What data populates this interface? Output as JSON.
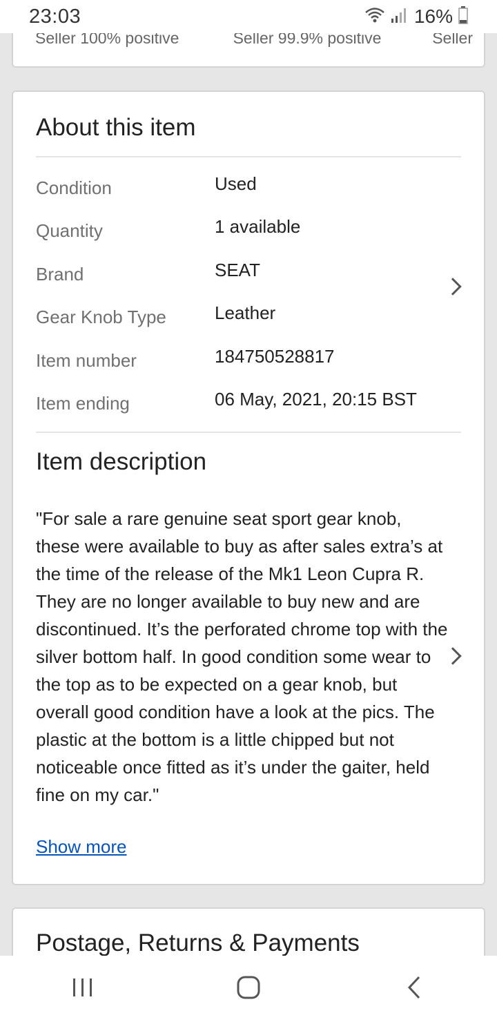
{
  "status_bar": {
    "time": "23:03",
    "battery_percent": "16%",
    "icons": [
      "wifi-icon",
      "signal-icon",
      "battery-icon"
    ]
  },
  "seller_card": {
    "sellers": [
      "Seller 100% positive",
      "Seller 99.9% positive",
      "Seller"
    ]
  },
  "about": {
    "title": "About this item",
    "specs": [
      {
        "label": "Condition",
        "value": "Used"
      },
      {
        "label": "Quantity",
        "value": "1 available"
      },
      {
        "label": "Brand",
        "value": "SEAT"
      },
      {
        "label": "Gear Knob Type",
        "value": "Leather"
      },
      {
        "label": "Item number",
        "value": "184750528817"
      },
      {
        "label": "Item ending",
        "value": "06 May, 2021, 20:15 BST"
      }
    ]
  },
  "description": {
    "title": "Item description",
    "text": "\"For sale a rare genuine seat sport gear knob, these were available to buy as after sales extra’s at the time of the release of the Mk1 Leon Cupra R. They are no longer available to buy new and are discontinued. It’s the perforated chrome top with the silver bottom half. In good condition some wear to the top as to be expected on a gear knob, but overall good condition have a look at the pics. The plastic at the bottom is a little chipped but not noticeable once fitted as it’s under the gaiter, held fine on my car.\"",
    "show_more": "Show more"
  },
  "postage": {
    "title": "Postage, Returns & Payments"
  },
  "nav_bar": {
    "icons": [
      "recent-apps-icon",
      "home-icon",
      "back-icon"
    ]
  },
  "colors": {
    "link": "#0654ba",
    "label": "#707070",
    "background": "#e6e6e6"
  }
}
